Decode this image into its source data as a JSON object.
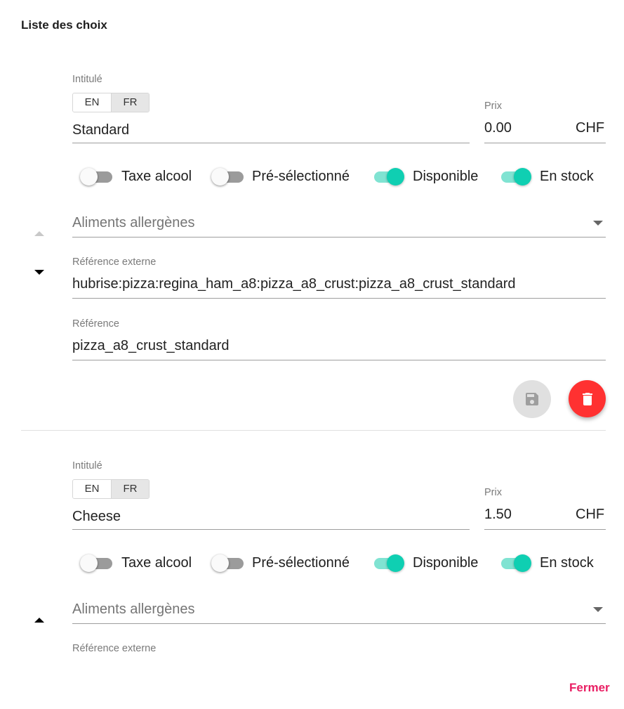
{
  "section_title": "Liste des choix",
  "choices": [
    {
      "intitule_label": "Intitulé",
      "lang_en": "EN",
      "lang_fr": "FR",
      "name": "Standard",
      "price_label": "Prix",
      "price": "0.00",
      "currency": "CHF",
      "toggles": {
        "alcohol": {
          "label": "Taxe alcool",
          "on": false
        },
        "preselected": {
          "label": "Pré-sélectionné",
          "on": false
        },
        "available": {
          "label": "Disponible",
          "on": true
        },
        "in_stock": {
          "label": "En stock",
          "on": true
        }
      },
      "allergens_placeholder": "Aliments allergènes",
      "external_ref_label": "Référence externe",
      "external_ref": "hubrise:pizza:regina_ham_a8:pizza_a8_crust:pizza_a8_crust_standard",
      "ref_label": "Référence",
      "ref": "pizza_a8_crust_standard"
    },
    {
      "intitule_label": "Intitulé",
      "lang_en": "EN",
      "lang_fr": "FR",
      "name": "Cheese",
      "price_label": "Prix",
      "price": "1.50",
      "currency": "CHF",
      "toggles": {
        "alcohol": {
          "label": "Taxe alcool",
          "on": false
        },
        "preselected": {
          "label": "Pré-sélectionné",
          "on": false
        },
        "available": {
          "label": "Disponible",
          "on": true
        },
        "in_stock": {
          "label": "En stock",
          "on": true
        }
      },
      "allergens_placeholder": "Aliments allergènes",
      "external_ref_label": "Référence externe"
    }
  ],
  "icons": {
    "move_up": "arrow-up-icon",
    "move_down": "arrow-down-icon",
    "dropdown": "caret-down-icon",
    "save": "floppy-disk-icon",
    "delete": "trash-icon"
  },
  "colors": {
    "toggle_on": "#0fcfb2",
    "delete_button": "#ff3131",
    "close_link": "#e91e63"
  },
  "footer": {
    "close_label": "Fermer"
  }
}
